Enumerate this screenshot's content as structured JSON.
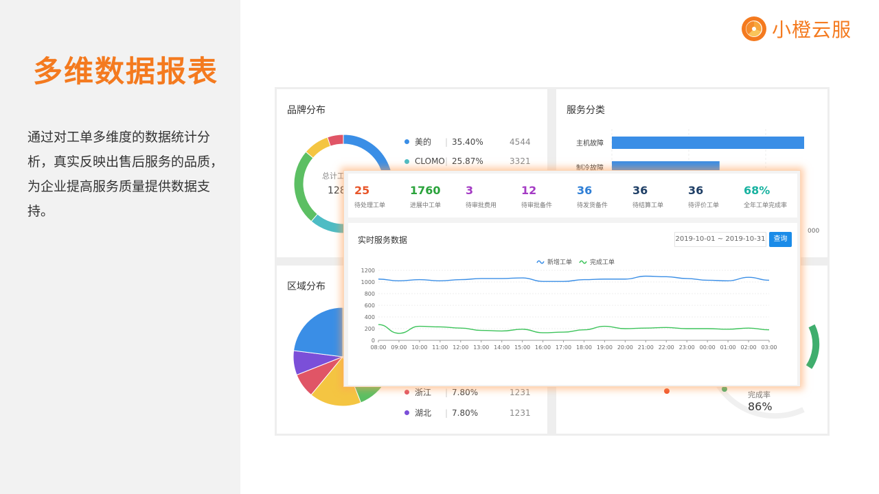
{
  "slide": {
    "title": "多维数据报表",
    "description": "通过对工单多维度的数据统计分析，真实反映出售后服务的品质，为企业提高服务质量提供数据支持。"
  },
  "logo": {
    "text": "小橙云服"
  },
  "colors": {
    "accent": "#f47a1f",
    "blue": "#3a8ee6",
    "green": "#3cc35a"
  },
  "brand_card": {
    "title": "品牌分布",
    "center_label": "总计工",
    "center_value": "128",
    "legend": [
      {
        "name": "美的",
        "pct": "35.40%",
        "count": "4544",
        "color": "#3a8ee6"
      },
      {
        "name": "CLOMO",
        "pct": "25.87%",
        "count": "3321",
        "color": "#4dbcc4"
      }
    ],
    "slices": [
      {
        "value": 35.4,
        "color": "#3a8ee6"
      },
      {
        "value": 25.87,
        "color": "#4dbcc4"
      },
      {
        "value": 25.0,
        "color": "#5cbf63"
      },
      {
        "value": 8.5,
        "color": "#f4c542"
      },
      {
        "value": 5.23,
        "color": "#e05566"
      }
    ]
  },
  "service_card": {
    "title": "服务分类",
    "categories": [
      {
        "label": "主机故障",
        "value": 1.0
      },
      {
        "label": "制冷故障",
        "value": 0.56
      }
    ],
    "axis_fragment": "000"
  },
  "region_card": {
    "title": "区域分布",
    "legend": [
      {
        "name": "浙江",
        "pct": "7.80%",
        "count": "1231",
        "color": "#e05566"
      },
      {
        "name": "湖北",
        "pct": "7.80%",
        "count": "1231",
        "color": "#7b4fd8"
      }
    ],
    "slices": [
      {
        "value": 20,
        "color": "#4dbcc4"
      },
      {
        "value": 24,
        "color": "#5cbf63"
      },
      {
        "value": 17,
        "color": "#f4c542"
      },
      {
        "value": 8,
        "color": "#e05566"
      },
      {
        "value": 8,
        "color": "#7b4fd8"
      },
      {
        "value": 23,
        "color": "#3a8ee6"
      }
    ]
  },
  "completion_card": {
    "label": "完成率",
    "value": "86%",
    "rate": 0.86
  },
  "kpis": [
    {
      "value": "25",
      "label": "待处理工单",
      "color": "#e8562a"
    },
    {
      "value": "1760",
      "label": "进展中工单",
      "color": "#2aa33b"
    },
    {
      "value": "3",
      "label": "待审批费用",
      "color": "#a43bc4"
    },
    {
      "value": "12",
      "label": "待审批备件",
      "color": "#a43bc4"
    },
    {
      "value": "36",
      "label": "待发货备件",
      "color": "#2f7fd6"
    },
    {
      "value": "36",
      "label": "待结算工单",
      "color": "#1f3f66"
    },
    {
      "value": "36",
      "label": "待评价工单",
      "color": "#1f3f66"
    },
    {
      "value": "68%",
      "label": "全年工单完成率",
      "color": "#18b2a0"
    }
  ],
  "realtime": {
    "title": "实时服务数据",
    "date_range": "2019-10-01 ~ 2019-10-31",
    "query_label": "查询"
  },
  "chart_data": {
    "type": "line",
    "x": [
      "08:00",
      "09:00",
      "10:00",
      "11:00",
      "12:00",
      "13:00",
      "14:00",
      "15:00",
      "16:00",
      "17:00",
      "18:00",
      "19:00",
      "20:00",
      "21:00",
      "22:00",
      "23:00",
      "00:00",
      "01:00",
      "02:00",
      "03:00"
    ],
    "series": [
      {
        "name": "新增工单",
        "color": "#3a8ee6",
        "values": [
          1050,
          1020,
          1040,
          1020,
          1040,
          1060,
          1060,
          1070,
          1010,
          1010,
          1040,
          1050,
          1050,
          1100,
          1090,
          1060,
          1030,
          1020,
          1080,
          1030
        ]
      },
      {
        "name": "完成工单",
        "color": "#3cc35a",
        "values": [
          270,
          120,
          240,
          230,
          210,
          170,
          160,
          190,
          130,
          140,
          180,
          240,
          200,
          210,
          220,
          200,
          200,
          190,
          210,
          180
        ]
      }
    ],
    "ylim": [
      0,
      1200
    ],
    "yticks": [
      0,
      200,
      400,
      600,
      800,
      1000,
      1200
    ]
  }
}
